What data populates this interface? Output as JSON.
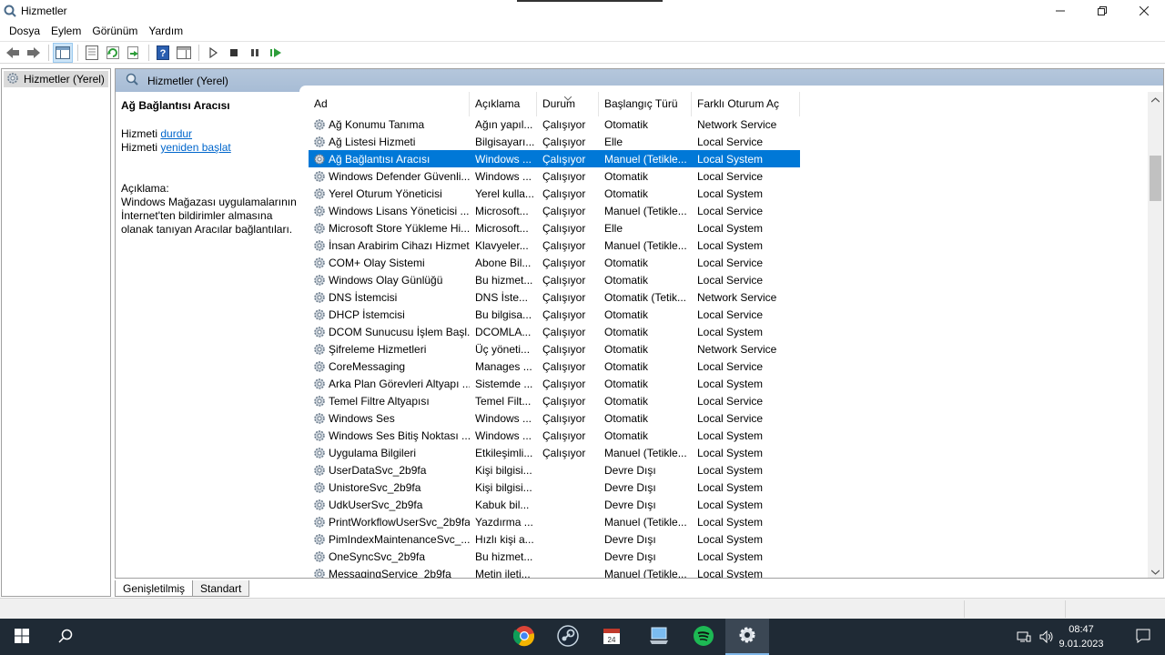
{
  "window": {
    "title": "Hizmetler"
  },
  "menu": [
    "Dosya",
    "Eylem",
    "Görünüm",
    "Yardım"
  ],
  "tree": {
    "root": "Hizmetler (Yerel)"
  },
  "pane": {
    "header": "Hizmetler (Yerel)"
  },
  "description": {
    "title": "Ağ Bağlantısı Aracısı",
    "stop_prefix": "Hizmeti",
    "stop_link": "durdur",
    "restart_prefix": "Hizmeti",
    "restart_link": "yeniden başlat",
    "label": "Açıklama:",
    "text_lines": [
      "Windows Mağazası uygulamalarının",
      "İnternet'ten bildirimler almasına",
      "olanak tanıyan Aracılar bağlantıları."
    ]
  },
  "columns": [
    "Ad",
    "Açıklama",
    "Durum",
    "Başlangıç Türü",
    "Farklı Oturum Aç"
  ],
  "selected_row": 2,
  "rows": [
    {
      "name": "Ağ Konumu Tanıma",
      "desc": "Ağın yapıl...",
      "status": "Çalışıyor",
      "start": "Otomatik",
      "logon": "Network Service"
    },
    {
      "name": "Ağ Listesi Hizmeti",
      "desc": "Bilgisayarı...",
      "status": "Çalışıyor",
      "start": "Elle",
      "logon": "Local Service"
    },
    {
      "name": "Ağ Bağlantısı Aracısı",
      "desc": "Windows ...",
      "status": "Çalışıyor",
      "start": "Manuel (Tetikle...",
      "logon": "Local System"
    },
    {
      "name": "Windows Defender Güvenli...",
      "desc": "Windows ...",
      "status": "Çalışıyor",
      "start": "Otomatik",
      "logon": "Local Service"
    },
    {
      "name": "Yerel Oturum Yöneticisi",
      "desc": "Yerel kulla...",
      "status": "Çalışıyor",
      "start": "Otomatik",
      "logon": "Local System"
    },
    {
      "name": "Windows Lisans Yöneticisi ...",
      "desc": "Microsoft...",
      "status": "Çalışıyor",
      "start": "Manuel (Tetikle...",
      "logon": "Local Service"
    },
    {
      "name": "Microsoft Store Yükleme Hi...",
      "desc": "Microsoft...",
      "status": "Çalışıyor",
      "start": "Elle",
      "logon": "Local System"
    },
    {
      "name": "İnsan Arabirim Cihazı Hizmeti",
      "desc": "Klavyeler...",
      "status": "Çalışıyor",
      "start": "Manuel (Tetikle...",
      "logon": "Local System"
    },
    {
      "name": "COM+ Olay Sistemi",
      "desc": "Abone Bil...",
      "status": "Çalışıyor",
      "start": "Otomatik",
      "logon": "Local Service"
    },
    {
      "name": "Windows Olay Günlüğü",
      "desc": "Bu hizmet...",
      "status": "Çalışıyor",
      "start": "Otomatik",
      "logon": "Local Service"
    },
    {
      "name": "DNS İstemcisi",
      "desc": "DNS İste...",
      "status": "Çalışıyor",
      "start": "Otomatik (Tetik...",
      "logon": "Network Service"
    },
    {
      "name": "DHCP İstemcisi",
      "desc": "Bu bilgisa...",
      "status": "Çalışıyor",
      "start": "Otomatik",
      "logon": "Local Service"
    },
    {
      "name": "DCOM Sunucusu İşlem Başl...",
      "desc": "DCOMLA...",
      "status": "Çalışıyor",
      "start": "Otomatik",
      "logon": "Local System"
    },
    {
      "name": "Şifreleme Hizmetleri",
      "desc": "Üç yöneti...",
      "status": "Çalışıyor",
      "start": "Otomatik",
      "logon": "Network Service"
    },
    {
      "name": "CoreMessaging",
      "desc": "Manages ...",
      "status": "Çalışıyor",
      "start": "Otomatik",
      "logon": "Local Service"
    },
    {
      "name": "Arka Plan Görevleri Altyapı ...",
      "desc": "Sistemde ...",
      "status": "Çalışıyor",
      "start": "Otomatik",
      "logon": "Local System"
    },
    {
      "name": "Temel Filtre Altyapısı",
      "desc": "Temel Filt...",
      "status": "Çalışıyor",
      "start": "Otomatik",
      "logon": "Local Service"
    },
    {
      "name": "Windows Ses",
      "desc": "Windows ...",
      "status": "Çalışıyor",
      "start": "Otomatik",
      "logon": "Local Service"
    },
    {
      "name": "Windows Ses Bitiş Noktası ...",
      "desc": "Windows ...",
      "status": "Çalışıyor",
      "start": "Otomatik",
      "logon": "Local System"
    },
    {
      "name": "Uygulama Bilgileri",
      "desc": "Etkileşimli...",
      "status": "Çalışıyor",
      "start": "Manuel (Tetikle...",
      "logon": "Local System"
    },
    {
      "name": "UserDataSvc_2b9fa",
      "desc": "Kişi bilgisi...",
      "status": "",
      "start": "Devre Dışı",
      "logon": "Local System"
    },
    {
      "name": "UnistoreSvc_2b9fa",
      "desc": "Kişi bilgisi...",
      "status": "",
      "start": "Devre Dışı",
      "logon": "Local System"
    },
    {
      "name": "UdkUserSvc_2b9fa",
      "desc": "Kabuk bil...",
      "status": "",
      "start": "Devre Dışı",
      "logon": "Local System"
    },
    {
      "name": "PrintWorkflowUserSvc_2b9fa",
      "desc": "Yazdırma ...",
      "status": "",
      "start": "Manuel (Tetikle...",
      "logon": "Local System"
    },
    {
      "name": "PimIndexMaintenanceSvc_...",
      "desc": "Hızlı kişi a...",
      "status": "",
      "start": "Devre Dışı",
      "logon": "Local System"
    },
    {
      "name": "OneSyncSvc_2b9fa",
      "desc": "Bu hizmet...",
      "status": "",
      "start": "Devre Dışı",
      "logon": "Local System"
    },
    {
      "name": "MessagingService_2b9fa",
      "desc": "Metin ileti...",
      "status": "",
      "start": "Manuel (Tetikle...",
      "logon": "Local System"
    }
  ],
  "tabs": [
    "Genişletilmiş",
    "Standart"
  ],
  "taskbar": {
    "apps": [
      "chrome-icon",
      "steam-icon",
      "calendar-app-icon",
      "remote-desktop-icon",
      "spotify-icon",
      "services-icon"
    ],
    "time": "08:47",
    "date": "9.01.2023"
  },
  "colors": {
    "selection": "#0078d7",
    "taskbar": "#1f2a35",
    "pane_header": "#adc1d8"
  }
}
